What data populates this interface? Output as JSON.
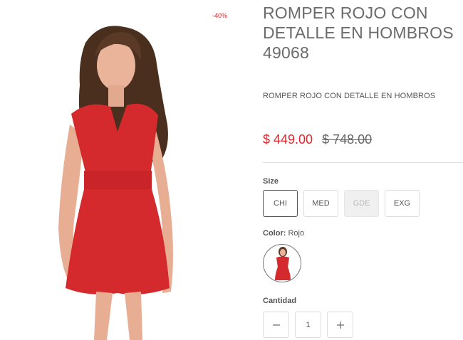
{
  "product": {
    "discount_badge": "-40%",
    "title": "ROMPER ROJO CON DETALLE EN HOMBROS 49068",
    "subtitle": "ROMPER ROJO CON DETALLE EN HOMBROS",
    "price": "$ 449.00",
    "old_price": "$ 748.00",
    "image_icon": "product-photo-red-romper"
  },
  "size": {
    "label": "Size",
    "options": [
      {
        "label": "CHI",
        "state": "selected"
      },
      {
        "label": "MED",
        "state": "available"
      },
      {
        "label": "GDE",
        "state": "unavailable"
      },
      {
        "label": "EXG",
        "state": "available"
      }
    ]
  },
  "color": {
    "label": "Color:",
    "value": "Rojo",
    "swatch_color": "#d42a2d"
  },
  "quantity": {
    "label": "Cantidad",
    "value": "1",
    "decrease_icon": "minus-icon",
    "increase_icon": "plus-icon"
  },
  "colors": {
    "accent_red": "#e0262c",
    "text_gray": "#6b6b6b",
    "border": "#dddddd"
  }
}
